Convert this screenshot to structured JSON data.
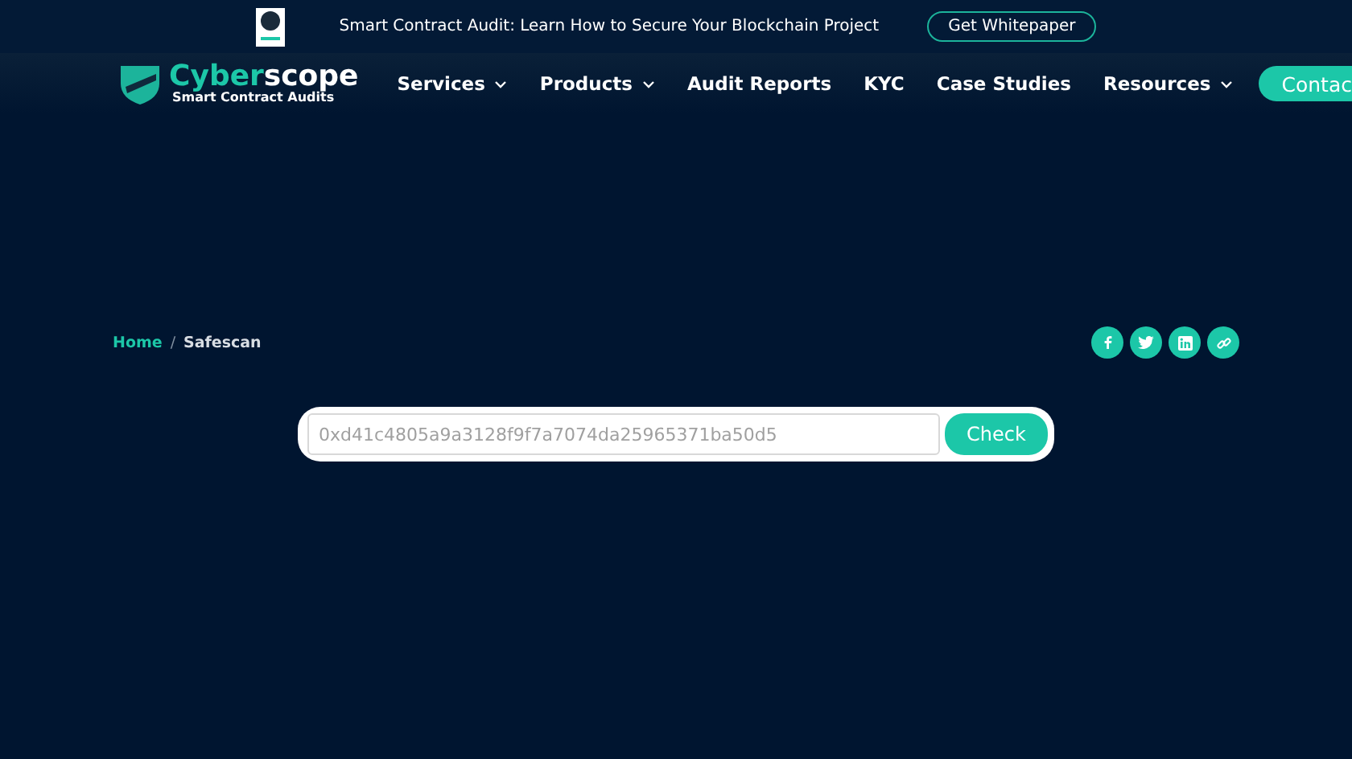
{
  "banner": {
    "text": "Smart Contract Audit: Learn How to Secure Your Blockchain Project",
    "button": "Get Whitepaper"
  },
  "logo": {
    "name_part_1": "Cyber",
    "name_part_2": "scope",
    "tagline": "Smart Contract Audits"
  },
  "nav": [
    {
      "label": "Services",
      "dropdown": true
    },
    {
      "label": "Products",
      "dropdown": true
    },
    {
      "label": "Audit Reports",
      "dropdown": false
    },
    {
      "label": "KYC",
      "dropdown": false
    },
    {
      "label": "Case Studies",
      "dropdown": false
    },
    {
      "label": "Resources",
      "dropdown": true
    }
  ],
  "contact_button": "Contac",
  "breadcrumb_separator": "/",
  "breadcrumb": [
    {
      "label": "Home",
      "kind": "link"
    },
    {
      "label": "Safescan",
      "kind": "current"
    }
  ],
  "share": [
    {
      "kind": "facebook"
    },
    {
      "kind": "twitter"
    },
    {
      "kind": "linkedin"
    },
    {
      "kind": "link"
    }
  ],
  "search": {
    "placeholder": "0xd41c4805a9a3128f9f7a7074da25965371ba50d5",
    "button": "Check"
  }
}
